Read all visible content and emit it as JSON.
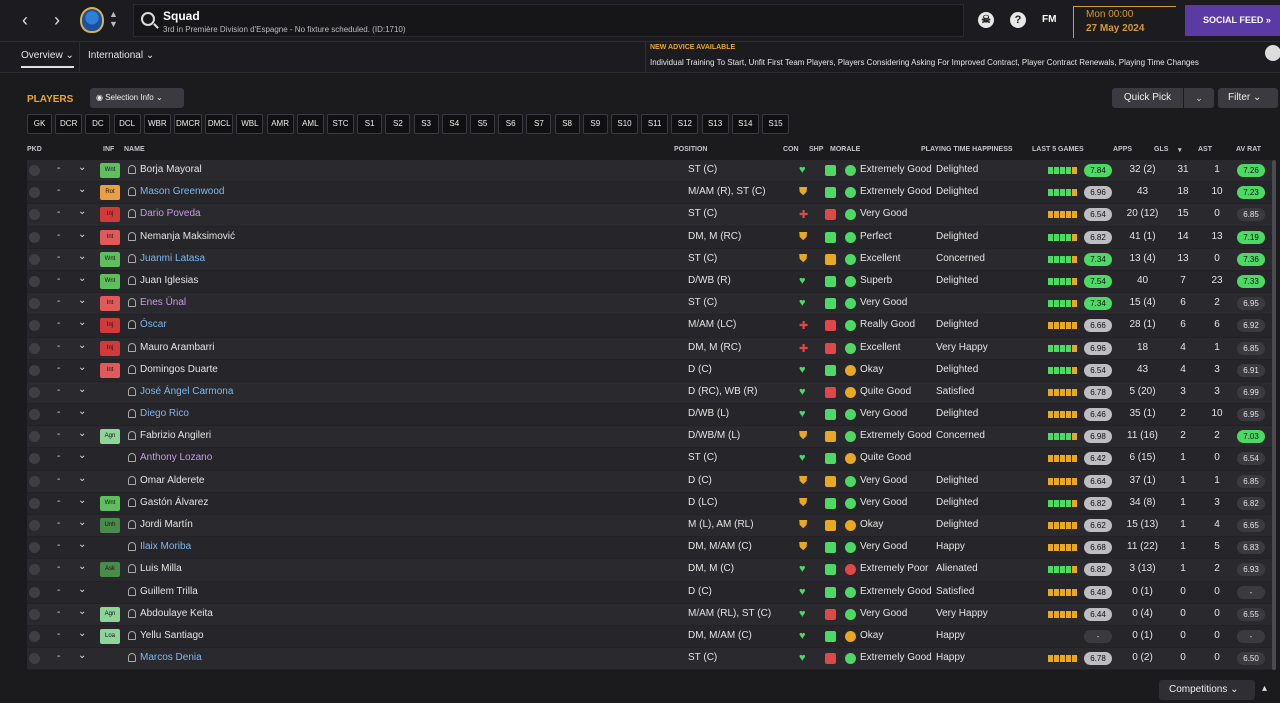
{
  "header": {
    "title": "Squad",
    "subtitle": "3rd in Première Division d'Espagne - No fixture scheduled. (ID:1710)",
    "fm_label": "FM",
    "day_time": "Mon 00:00",
    "date": "27 May 2024",
    "social_feed": "SOCIAL FEED"
  },
  "tabs": [
    "Overview",
    "International"
  ],
  "advice": {
    "heading": "NEW ADVICE AVAILABLE",
    "text": "Individual Training To Start, Unfit First Team Players, Players Considering Asking For Improved Contract, Player Contract Renewals, Playing Time Changes"
  },
  "panel": {
    "title": "PLAYERS",
    "selection_info": "Selection Info",
    "quick_pick": "Quick Pick",
    "filter": "Filter",
    "competitions": "Competitions"
  },
  "position_filters": [
    "GK",
    "DCR",
    "DC",
    "DCL",
    "WBR",
    "DMCR",
    "DMCL",
    "WBL",
    "AMR",
    "AML",
    "STC",
    "S1",
    "S2",
    "S3",
    "S4",
    "S5",
    "S6",
    "S7",
    "S8",
    "S9",
    "S10",
    "S11",
    "S12",
    "S13",
    "S14",
    "S15"
  ],
  "columns": {
    "pkd": "PKD",
    "inf": "INF",
    "name": "NAME",
    "position": "POSITION",
    "con": "CON",
    "shp": "SHP",
    "morale": "MORALE",
    "playing_time": "PLAYING TIME HAPPINESS",
    "last5": "LAST 5 GAMES",
    "apps": "APPS",
    "gls": "GLS",
    "ast": "AST",
    "av_rat": "AV RAT"
  },
  "colors": {
    "accent": "#e8a822",
    "social": "#5b3aa6",
    "good": "#4cd964",
    "warn": "#e8a822",
    "bad": "#e04848",
    "link": "#7db7ef",
    "loan": "#c99ae6"
  },
  "players": [
    {
      "inf": "Wnt",
      "inf_color": "#5fbf5f",
      "name": "Borja Mayoral",
      "name_color": "#e4e4e4",
      "position": "ST (C)",
      "con": "heart",
      "shp": "#4cd964",
      "morale_icon": "#4cd964",
      "morale": "Extremely Good",
      "pt": "Delighted",
      "form": "ggggo",
      "last5": "7.84",
      "last5_hi": true,
      "apps": "32 (2)",
      "gls": "31",
      "ast": "1",
      "av": "7.26",
      "av_hi": true
    },
    {
      "inf": "Rot",
      "inf_color": "#e8a040",
      "name": "Mason Greenwood",
      "name_color": "#7db7ef",
      "position": "M/AM (R), ST (C)",
      "con": "shield",
      "shp": "#4cd964",
      "morale_icon": "#4cd964",
      "morale": "Extremely Good",
      "pt": "Delighted",
      "form": "ggggo",
      "last5": "6.96",
      "last5_hi": false,
      "apps": "43",
      "gls": "18",
      "ast": "10",
      "av": "7.23",
      "av_hi": true
    },
    {
      "inf": "Inj",
      "inf_color": "#d03a3a",
      "name": "Dario Poveda",
      "name_color": "#c99ae6",
      "position": "ST (C)",
      "con": "cross",
      "shp": "#e04848",
      "morale_icon": "#4cd964",
      "morale": "Very Good",
      "pt": "",
      "form": "ooooo",
      "last5": "6.54",
      "last5_hi": false,
      "apps": "20 (12)",
      "gls": "15",
      "ast": "0",
      "av": "6.85",
      "av_hi": false
    },
    {
      "inf": "Int",
      "inf_color": "#e05a5a",
      "name": "Nemanja Maksimović",
      "name_color": "#e4e4e4",
      "position": "DM, M (RC)",
      "con": "shield",
      "shp": "#4cd964",
      "morale_icon": "#4cd964",
      "morale": "Perfect",
      "pt": "Delighted",
      "form": "ggggo",
      "last5": "6.82",
      "last5_hi": false,
      "apps": "41 (1)",
      "gls": "14",
      "ast": "13",
      "av": "7.19",
      "av_hi": true
    },
    {
      "inf": "Wnt",
      "inf_color": "#5fbf5f",
      "name": "Juanmi Latasa",
      "name_color": "#7db7ef",
      "position": "ST (C)",
      "con": "shield",
      "shp": "#e8a822",
      "morale_icon": "#4cd964",
      "morale": "Excellent",
      "pt": "Concerned",
      "form": "ggggo",
      "last5": "7.34",
      "last5_hi": true,
      "apps": "13 (4)",
      "gls": "13",
      "ast": "0",
      "av": "7.36",
      "av_hi": true
    },
    {
      "inf": "Wnt",
      "inf_color": "#5fbf5f",
      "name": "Juan Iglesias",
      "name_color": "#e4e4e4",
      "position": "D/WB (R)",
      "con": "heart",
      "shp": "#4cd964",
      "morale_icon": "#4cd964",
      "morale": "Superb",
      "pt": "Delighted",
      "form": "ggggo",
      "last5": "7.54",
      "last5_hi": true,
      "apps": "40",
      "gls": "7",
      "ast": "23",
      "av": "7.33",
      "av_hi": true
    },
    {
      "inf": "Int",
      "inf_color": "#e05a5a",
      "name": "Enes Ünal",
      "name_color": "#c99ae6",
      "position": "ST (C)",
      "con": "heart",
      "shp": "#4cd964",
      "morale_icon": "#4cd964",
      "morale": "Very Good",
      "pt": "",
      "form": "ggggo",
      "last5": "7.34",
      "last5_hi": true,
      "apps": "15 (4)",
      "gls": "6",
      "ast": "2",
      "av": "6.95",
      "av_hi": false
    },
    {
      "inf": "Inj",
      "inf_color": "#d03a3a",
      "name": "Óscar",
      "name_color": "#7db7ef",
      "position": "M/AM (LC)",
      "con": "cross",
      "shp": "#e04848",
      "morale_icon": "#4cd964",
      "morale": "Really Good",
      "pt": "Delighted",
      "form": "ooooo",
      "last5": "6.66",
      "last5_hi": false,
      "apps": "28 (1)",
      "gls": "6",
      "ast": "6",
      "av": "6.92",
      "av_hi": false
    },
    {
      "inf": "Inj",
      "inf_color": "#d03a3a",
      "name": "Mauro Arambarri",
      "name_color": "#e4e4e4",
      "position": "DM, M (RC)",
      "con": "cross",
      "shp": "#e04848",
      "morale_icon": "#4cd964",
      "morale": "Excellent",
      "pt": "Very Happy",
      "form": "ggggo",
      "last5": "6.96",
      "last5_hi": false,
      "apps": "18",
      "gls": "4",
      "ast": "1",
      "av": "6.85",
      "av_hi": false
    },
    {
      "inf": "Int",
      "inf_color": "#e05a5a",
      "name": "Domingos Duarte",
      "name_color": "#e4e4e4",
      "position": "D (C)",
      "con": "heart",
      "shp": "#4cd964",
      "morale_icon": "#e8a822",
      "morale": "Okay",
      "pt": "Delighted",
      "form": "ggggo",
      "last5": "6.54",
      "last5_hi": false,
      "apps": "43",
      "gls": "4",
      "ast": "3",
      "av": "6.91",
      "av_hi": false
    },
    {
      "inf": "",
      "inf_color": "",
      "name": "José Ángel Carmona",
      "name_color": "#7db7ef",
      "position": "D (RC), WB (R)",
      "con": "heart",
      "shp": "#e04848",
      "morale_icon": "#e8a822",
      "morale": "Quite Good",
      "pt": "Satisfied",
      "form": "ooooo",
      "last5": "6.78",
      "last5_hi": false,
      "apps": "5 (20)",
      "gls": "3",
      "ast": "3",
      "av": "6.99",
      "av_hi": false
    },
    {
      "inf": "",
      "inf_color": "",
      "name": "Diego Rico",
      "name_color": "#7db7ef",
      "position": "D/WB (L)",
      "con": "heart",
      "shp": "#4cd964",
      "morale_icon": "#4cd964",
      "morale": "Very Good",
      "pt": "Delighted",
      "form": "ooooo",
      "last5": "6.46",
      "last5_hi": false,
      "apps": "35 (1)",
      "gls": "2",
      "ast": "10",
      "av": "6.95",
      "av_hi": false
    },
    {
      "inf": "Agn",
      "inf_color": "#8fd49a",
      "name": "Fabrizio Angileri",
      "name_color": "#e4e4e4",
      "position": "D/WB/M (L)",
      "con": "shield",
      "shp": "#e8a822",
      "morale_icon": "#4cd964",
      "morale": "Extremely Good",
      "pt": "Concerned",
      "form": "ggggo",
      "last5": "6.98",
      "last5_hi": false,
      "apps": "11 (16)",
      "gls": "2",
      "ast": "2",
      "av": "7.03",
      "av_hi": true
    },
    {
      "inf": "",
      "inf_color": "",
      "name": "Anthony Lozano",
      "name_color": "#c99ae6",
      "position": "ST (C)",
      "con": "heart",
      "shp": "#4cd964",
      "morale_icon": "#e8a822",
      "morale": "Quite Good",
      "pt": "",
      "form": "ooooo",
      "last5": "6.42",
      "last5_hi": false,
      "apps": "6 (15)",
      "gls": "1",
      "ast": "0",
      "av": "6.54",
      "av_hi": false
    },
    {
      "inf": "",
      "inf_color": "",
      "name": "Omar Alderete",
      "name_color": "#e4e4e4",
      "position": "D (C)",
      "con": "shield",
      "shp": "#e8a822",
      "morale_icon": "#4cd964",
      "morale": "Very Good",
      "pt": "Delighted",
      "form": "ooooo",
      "last5": "6.64",
      "last5_hi": false,
      "apps": "37 (1)",
      "gls": "1",
      "ast": "1",
      "av": "6.85",
      "av_hi": false
    },
    {
      "inf": "Wnt",
      "inf_color": "#5fbf5f",
      "name": "Gastón Álvarez",
      "name_color": "#e4e4e4",
      "position": "D (LC)",
      "con": "shield",
      "shp": "#4cd964",
      "morale_icon": "#4cd964",
      "morale": "Very Good",
      "pt": "Delighted",
      "form": "ggggo",
      "last5": "6.82",
      "last5_hi": false,
      "apps": "34 (8)",
      "gls": "1",
      "ast": "3",
      "av": "6.82",
      "av_hi": false
    },
    {
      "inf": "Unh",
      "inf_color": "#4a8a4a",
      "name": "Jordi Martín",
      "name_color": "#e4e4e4",
      "position": "M (L), AM (RL)",
      "con": "shield",
      "shp": "#e8a822",
      "morale_icon": "#e8a822",
      "morale": "Okay",
      "pt": "Delighted",
      "form": "ooooo",
      "last5": "6.62",
      "last5_hi": false,
      "apps": "15 (13)",
      "gls": "1",
      "ast": "4",
      "av": "6.65",
      "av_hi": false
    },
    {
      "inf": "",
      "inf_color": "",
      "name": "Ilaix Moriba",
      "name_color": "#7db7ef",
      "position": "DM, M/AM (C)",
      "con": "shield",
      "shp": "#4cd964",
      "morale_icon": "#4cd964",
      "morale": "Very Good",
      "pt": "Happy",
      "form": "ooooo",
      "last5": "6.68",
      "last5_hi": false,
      "apps": "11 (22)",
      "gls": "1",
      "ast": "5",
      "av": "6.83",
      "av_hi": false
    },
    {
      "inf": "Ask",
      "inf_color": "#4a8a4a",
      "name": "Luis Milla",
      "name_color": "#e4e4e4",
      "position": "DM, M (C)",
      "con": "heart",
      "shp": "#4cd964",
      "morale_icon": "#e04848",
      "morale": "Extremely Poor",
      "pt": "Alienated",
      "form": "ggggo",
      "last5": "6.82",
      "last5_hi": false,
      "apps": "3 (13)",
      "gls": "1",
      "ast": "2",
      "av": "6.93",
      "av_hi": false
    },
    {
      "inf": "",
      "inf_color": "",
      "name": "Guillem Trilla",
      "name_color": "#e4e4e4",
      "position": "D (C)",
      "con": "heart",
      "shp": "#4cd964",
      "morale_icon": "#4cd964",
      "morale": "Extremely Good",
      "pt": "Satisfied",
      "form": "ooooo",
      "last5": "6.48",
      "last5_hi": false,
      "apps": "0 (1)",
      "gls": "0",
      "ast": "0",
      "av": "-",
      "av_hi": false
    },
    {
      "inf": "Agn",
      "inf_color": "#8fd49a",
      "name": "Abdoulaye Keita",
      "name_color": "#e4e4e4",
      "position": "M/AM (RL), ST (C)",
      "con": "heart",
      "shp": "#e04848",
      "morale_icon": "#4cd964",
      "morale": "Very Good",
      "pt": "Very Happy",
      "form": "ooooo",
      "last5": "6.44",
      "last5_hi": false,
      "apps": "0 (4)",
      "gls": "0",
      "ast": "0",
      "av": "6.55",
      "av_hi": false
    },
    {
      "inf": "Loa",
      "inf_color": "#8fd49a",
      "name": "Yellu Santiago",
      "name_color": "#e4e4e4",
      "position": "DM, M/AM (C)",
      "con": "heart",
      "shp": "#4cd964",
      "morale_icon": "#e8a822",
      "morale": "Okay",
      "pt": "Happy",
      "form": "",
      "last5": "-",
      "last5_hi": false,
      "apps": "0 (1)",
      "gls": "0",
      "ast": "0",
      "av": "-",
      "av_hi": false
    },
    {
      "inf": "",
      "inf_color": "",
      "name": "Marcos Denia",
      "name_color": "#7db7ef",
      "position": "ST (C)",
      "con": "heart",
      "shp": "#e04848",
      "morale_icon": "#4cd964",
      "morale": "Extremely Good",
      "pt": "Happy",
      "form": "ooooo",
      "last5": "6.78",
      "last5_hi": false,
      "apps": "0 (2)",
      "gls": "0",
      "ast": "0",
      "av": "6.50",
      "av_hi": false
    }
  ]
}
